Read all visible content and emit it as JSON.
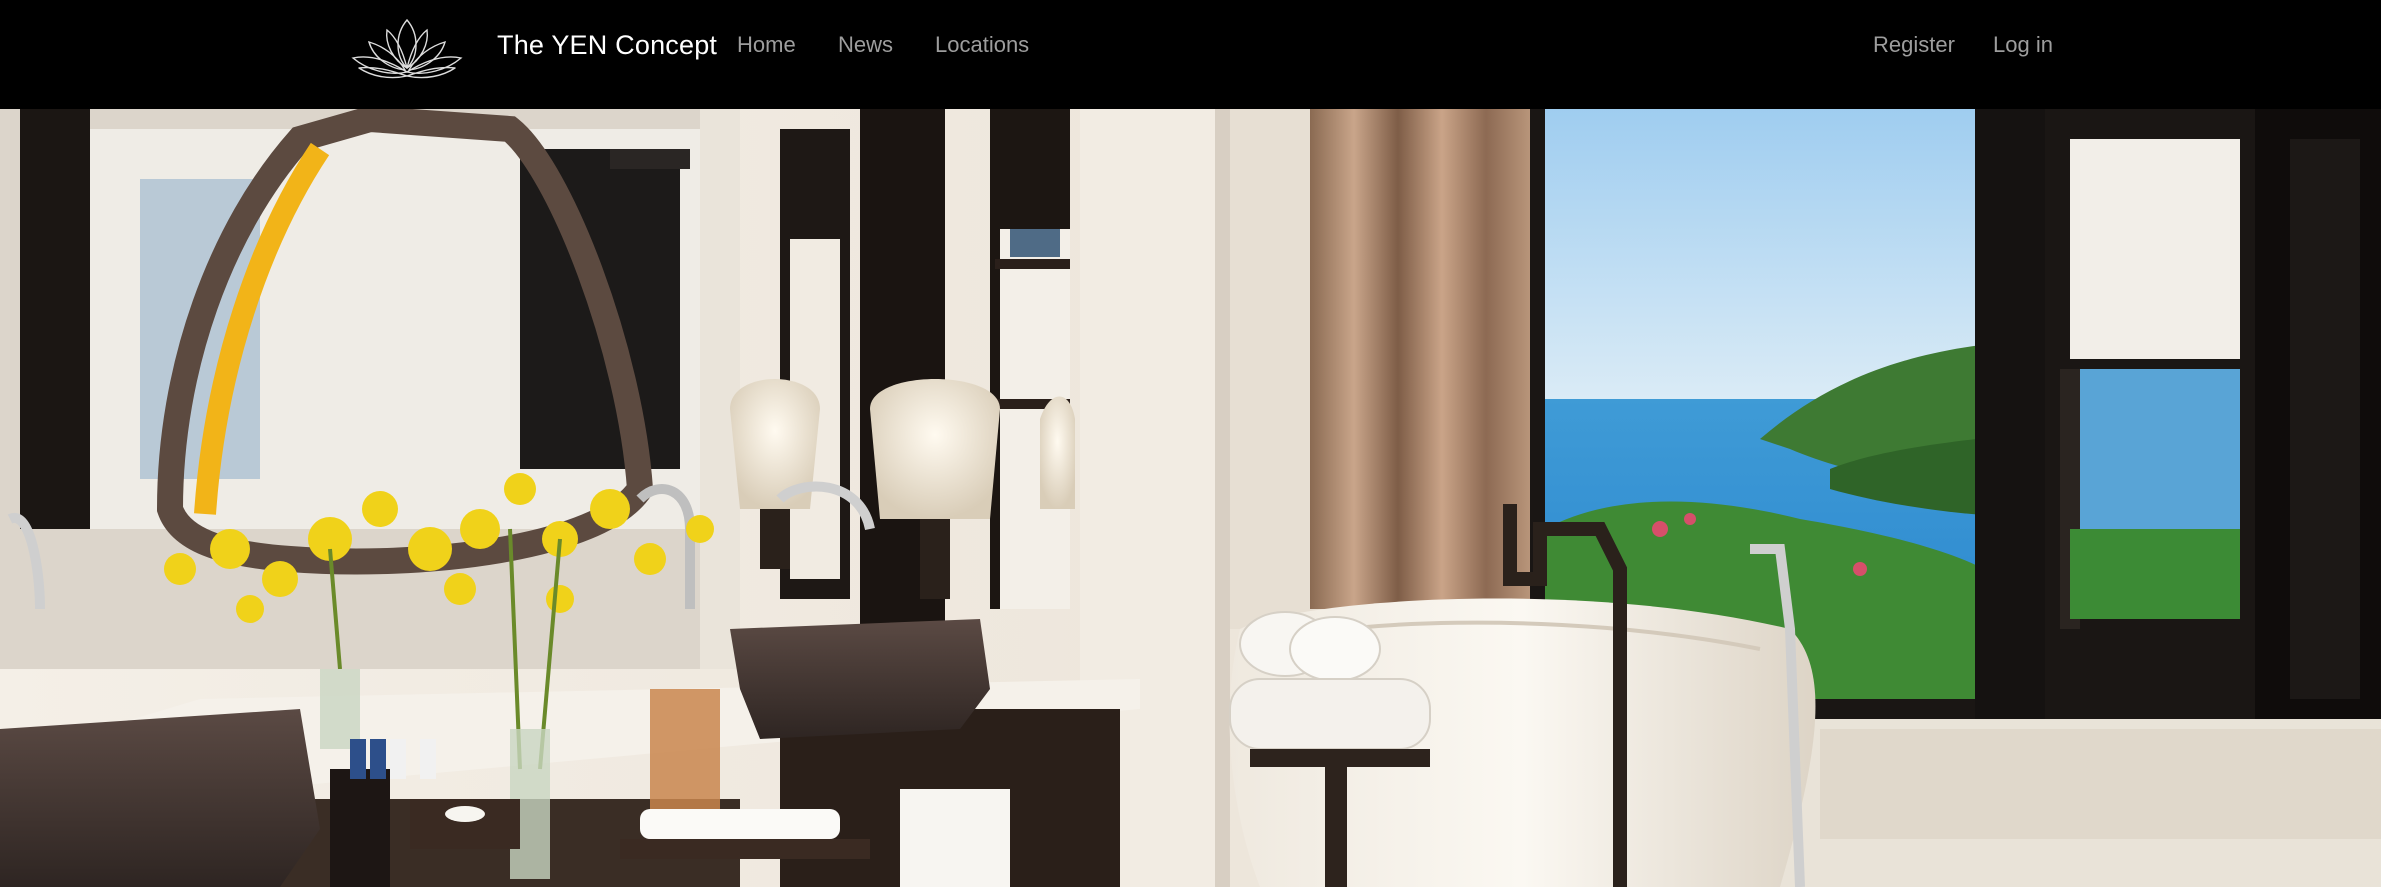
{
  "brand": {
    "name": "The YEN Concept",
    "logo_icon": "lotus-icon"
  },
  "nav": {
    "left": [
      {
        "label": "Home"
      },
      {
        "label": "News"
      },
      {
        "label": "Locations"
      }
    ],
    "right": [
      {
        "label": "Register"
      },
      {
        "label": "Log in"
      }
    ]
  },
  "colors": {
    "navbar_bg": "#000000",
    "brand_text": "#ffffff",
    "nav_link": "#9d9d9d"
  },
  "hero": {
    "subject": "hotel-bathroom-with-sea-view-photo"
  }
}
